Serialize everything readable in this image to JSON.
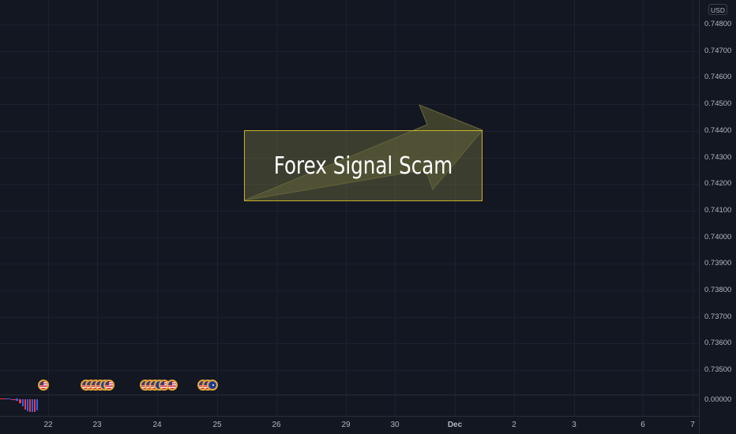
{
  "chart": {
    "currency": "USD",
    "price_ticks": [
      "0.74800",
      "0.74700",
      "0.74600",
      "0.74500",
      "0.74400",
      "0.74300",
      "0.74200",
      "0.74100",
      "0.74000",
      "0.73900",
      "0.73800",
      "0.73700",
      "0.73600",
      "0.73500"
    ],
    "indicator_tick": "0.00000",
    "date_ticks": [
      "22",
      "23",
      "24",
      "25",
      "26",
      "29",
      "30",
      "Dec",
      "2",
      "3",
      "6",
      "7"
    ],
    "annotation": {
      "text": "Forex Signal Scam"
    },
    "events": [
      {
        "flag": "us"
      },
      {
        "flag": "us"
      },
      {
        "flag": "us"
      },
      {
        "flag": "us"
      },
      {
        "flag": "us"
      },
      {
        "flag": "au"
      },
      {
        "flag": "us"
      },
      {
        "flag": "us"
      },
      {
        "flag": "us"
      },
      {
        "flag": "us"
      },
      {
        "flag": "au"
      },
      {
        "flag": "us"
      },
      {
        "flag": "us"
      },
      {
        "flag": "us"
      },
      {
        "flag": "us"
      },
      {
        "flag": "au"
      }
    ],
    "colors": {
      "background": "#131722",
      "annotation_border": "#c9b12a",
      "annotation_fill": "#5c5e3a",
      "event_ring": "#e3a73a",
      "bar_red": "#f23645",
      "bar_blue": "#2962ff"
    }
  }
}
